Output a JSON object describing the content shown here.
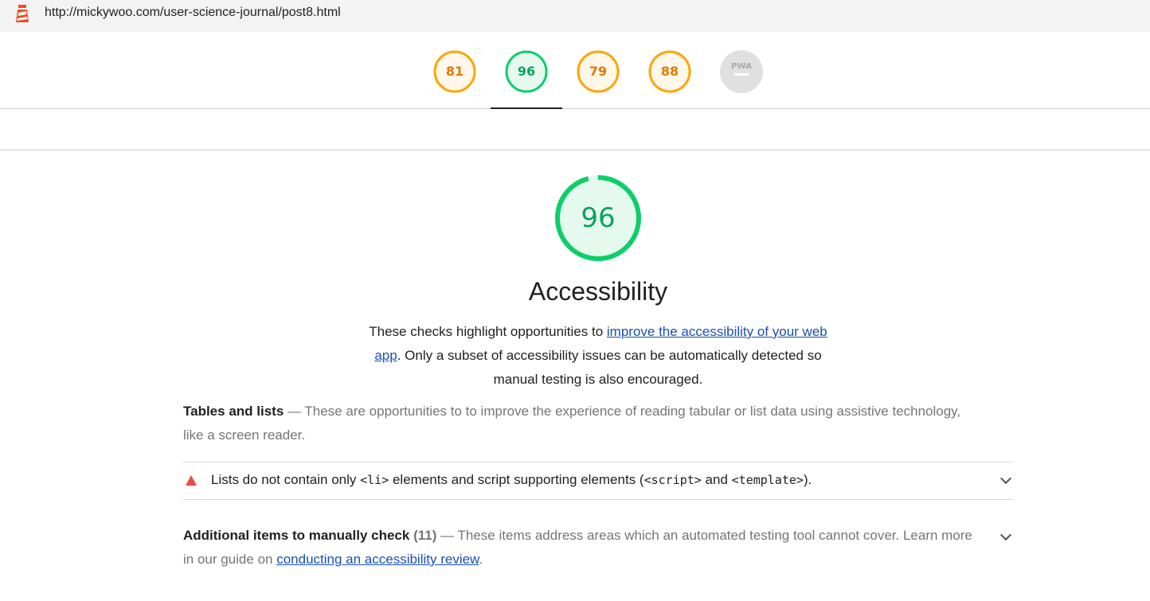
{
  "url": "http://mickywoo.com/user-science-journal/post8.html",
  "gauges": [
    {
      "score": "81",
      "color": "#ffa400",
      "fill": "#fff7ea"
    },
    {
      "score": "96",
      "color": "#0cce6b",
      "fill": "#e6f9ee"
    },
    {
      "score": "79",
      "color": "#ffa400",
      "fill": "#fff7ea"
    },
    {
      "score": "88",
      "color": "#ffa400",
      "fill": "#fff7ea"
    },
    {
      "score": "PWA",
      "color": "#cccccc",
      "fill": "#e0e0e0"
    }
  ],
  "category": {
    "score": "96",
    "title": "Accessibility",
    "desc_before": "These checks highlight opportunities to ",
    "desc_link": "improve the accessibility of your web app",
    "desc_after": ". Only a subset of accessibility issues can be automatically detected so manual testing is also encouraged."
  },
  "tables_group": {
    "title": "Tables and lists",
    "separator": " — ",
    "description": "These are opportunities to to improve the experience of reading tabular or list data using assistive technology, like a screen reader."
  },
  "audit": {
    "text_1": "Lists do not contain only ",
    "code_1": "<li>",
    "text_2": " elements and script supporting elements (",
    "code_2": "<script>",
    "text_3": " and ",
    "code_3": "<template>",
    "text_4": ")."
  },
  "manual_group": {
    "title": "Additional items to manually check",
    "count": "(11)",
    "separator": " — ",
    "description": "These items address areas which an automated testing tool cannot cover. Learn more in our guide on ",
    "link": "conducting an accessibility review",
    "end": "."
  }
}
